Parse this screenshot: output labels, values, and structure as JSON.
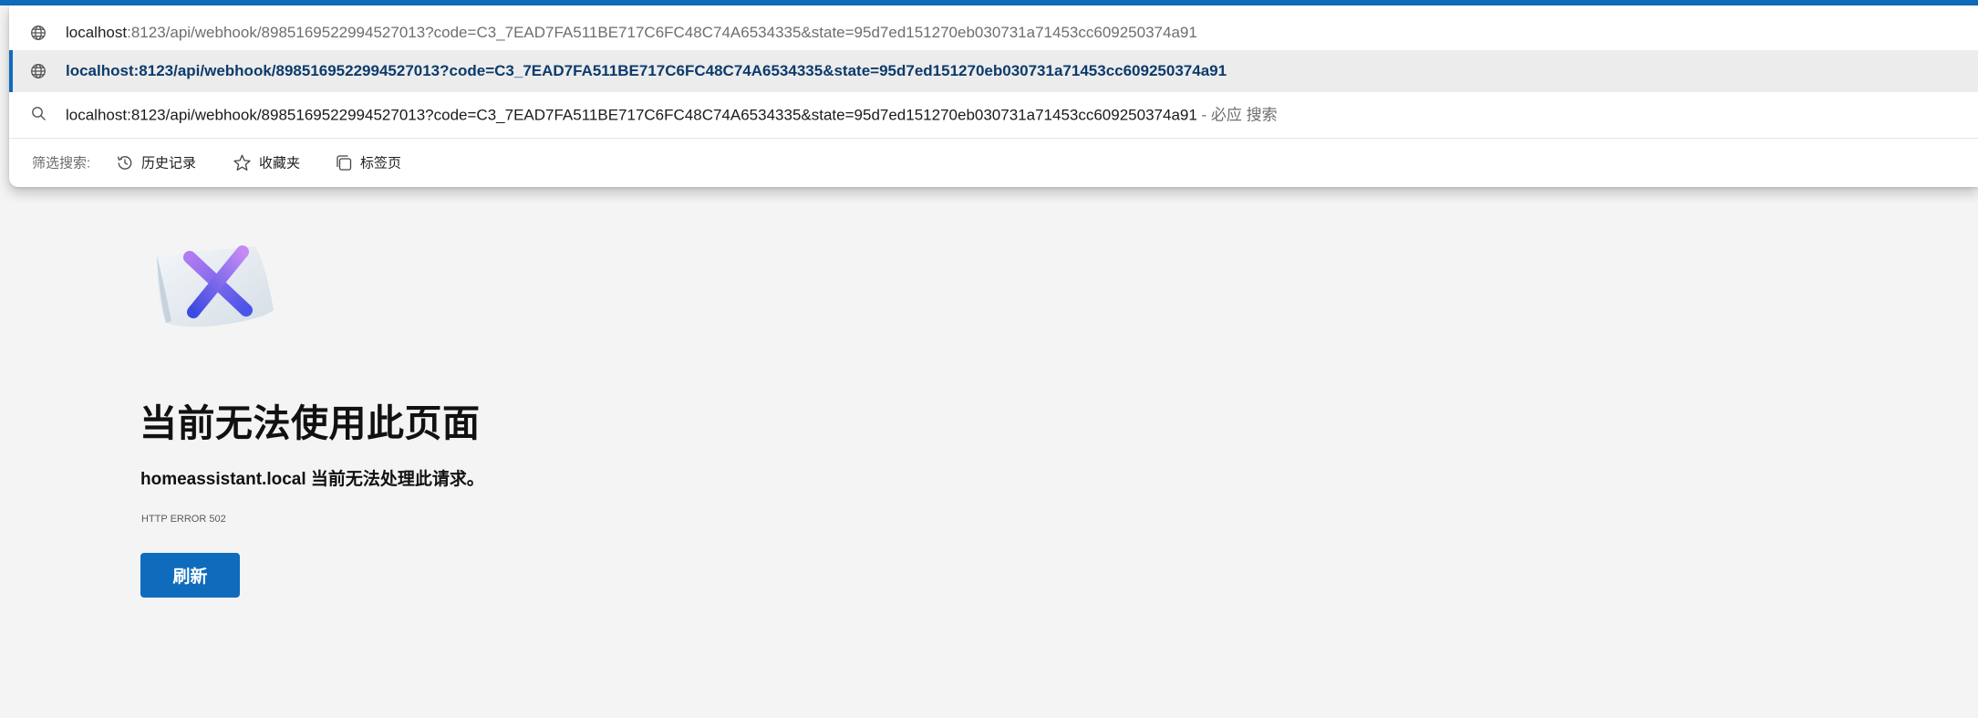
{
  "omnibox": {
    "typed_url": {
      "host": "localhost",
      "rest": ":8123/api/webhook/8985169522994527013?code=C3_7EAD7FA511BE717C6FC48C74A6534335&state=95d7ed151270eb030731a71453cc609250374a91",
      "icon": "globe-icon"
    },
    "suggestion_url": {
      "text": "localhost:8123/api/webhook/8985169522994527013?code=C3_7EAD7FA511BE717C6FC48C74A6534335&state=95d7ed151270eb030731a71453cc609250374a91",
      "icon": "globe-icon"
    },
    "search_suggestion": {
      "query": "localhost:8123/api/webhook/8985169522994527013?code=C3_7EAD7FA511BE717C6FC48C74A6534335&state=95d7ed151270eb030731a71453cc609250374a91",
      "suffix": " - 必应 搜索",
      "icon": "search-icon"
    },
    "filter": {
      "label": "筛选搜索:",
      "history": "历史记录",
      "favorites": "收藏夹",
      "tabs": "标签页"
    }
  },
  "error_page": {
    "title": "当前无法使用此页面",
    "description": "homeassistant.local 当前无法处理此请求。",
    "error_code": "HTTP ERROR 502",
    "reload_label": "刷新"
  },
  "colors": {
    "accent": "#0f6cbd",
    "page_background": "#f4f4f4"
  }
}
